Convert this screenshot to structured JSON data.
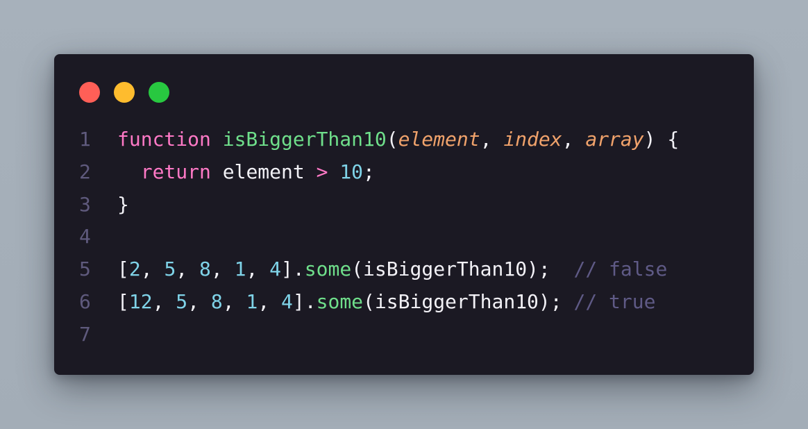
{
  "window": {
    "controls": [
      {
        "name": "close",
        "color": "#ff5f57"
      },
      {
        "name": "minimize",
        "color": "#febc2e"
      },
      {
        "name": "maximize",
        "color": "#28c840"
      }
    ]
  },
  "colors": {
    "background": "#a7b1bb",
    "editor_background": "#1b1923",
    "line_number": "#5f5a7d",
    "keyword": "#ff79c6",
    "function": "#6fdf8b",
    "parameter": "#f0a26b",
    "number": "#7fd3e8",
    "text": "#f2f1f6",
    "comment": "#5f5a86"
  },
  "code": {
    "lines": [
      {
        "number": "1",
        "tokens": [
          {
            "t": "function",
            "k": "kw"
          },
          {
            "t": " ",
            "k": "punct"
          },
          {
            "t": "isBiggerThan10",
            "k": "fn"
          },
          {
            "t": "(",
            "k": "punct"
          },
          {
            "t": "element",
            "k": "param"
          },
          {
            "t": ", ",
            "k": "punct"
          },
          {
            "t": "index",
            "k": "param"
          },
          {
            "t": ", ",
            "k": "punct"
          },
          {
            "t": "array",
            "k": "param"
          },
          {
            "t": ") {",
            "k": "punct"
          }
        ]
      },
      {
        "number": "2",
        "tokens": [
          {
            "t": "  ",
            "k": "punct"
          },
          {
            "t": "return",
            "k": "kw"
          },
          {
            "t": " element ",
            "k": "id"
          },
          {
            "t": ">",
            "k": "op"
          },
          {
            "t": " ",
            "k": "punct"
          },
          {
            "t": "10",
            "k": "num"
          },
          {
            "t": ";",
            "k": "punct"
          }
        ]
      },
      {
        "number": "3",
        "tokens": [
          {
            "t": "}",
            "k": "punct"
          }
        ]
      },
      {
        "number": "4",
        "tokens": []
      },
      {
        "number": "5",
        "tokens": [
          {
            "t": "[",
            "k": "punct"
          },
          {
            "t": "2",
            "k": "num"
          },
          {
            "t": ", ",
            "k": "punct"
          },
          {
            "t": "5",
            "k": "num"
          },
          {
            "t": ", ",
            "k": "punct"
          },
          {
            "t": "8",
            "k": "num"
          },
          {
            "t": ", ",
            "k": "punct"
          },
          {
            "t": "1",
            "k": "num"
          },
          {
            "t": ", ",
            "k": "punct"
          },
          {
            "t": "4",
            "k": "num"
          },
          {
            "t": "].",
            "k": "punct"
          },
          {
            "t": "some",
            "k": "fn"
          },
          {
            "t": "(isBiggerThan10);  ",
            "k": "id"
          },
          {
            "t": "// false",
            "k": "comment"
          }
        ]
      },
      {
        "number": "6",
        "tokens": [
          {
            "t": "[",
            "k": "punct"
          },
          {
            "t": "12",
            "k": "num"
          },
          {
            "t": ", ",
            "k": "punct"
          },
          {
            "t": "5",
            "k": "num"
          },
          {
            "t": ", ",
            "k": "punct"
          },
          {
            "t": "8",
            "k": "num"
          },
          {
            "t": ", ",
            "k": "punct"
          },
          {
            "t": "1",
            "k": "num"
          },
          {
            "t": ", ",
            "k": "punct"
          },
          {
            "t": "4",
            "k": "num"
          },
          {
            "t": "].",
            "k": "punct"
          },
          {
            "t": "some",
            "k": "fn"
          },
          {
            "t": "(isBiggerThan10); ",
            "k": "id"
          },
          {
            "t": "// true",
            "k": "comment"
          }
        ]
      },
      {
        "number": "7",
        "tokens": []
      }
    ]
  }
}
